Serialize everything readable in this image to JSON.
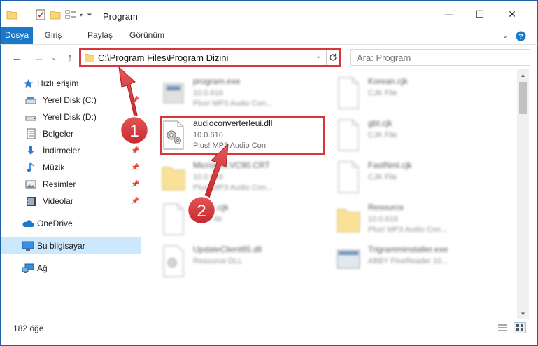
{
  "window": {
    "title": "Program",
    "controls": {
      "minimize": "—",
      "maximize": "☐",
      "close": "✕"
    }
  },
  "ribbon": {
    "tabs": [
      "Dosya",
      "Giriş",
      "Paylaş",
      "Görünüm"
    ]
  },
  "address": {
    "path": "C:\\Program Files\\Program Dizini",
    "search_placeholder": "Ara: Program"
  },
  "navpane": {
    "quick_access": "Hızlı erişim",
    "items": [
      {
        "label": "Yerel Disk (C:)",
        "icon": "drive-icon",
        "pinned": true
      },
      {
        "label": "Yerel Disk (D:)",
        "icon": "drive-icon",
        "pinned": false
      },
      {
        "label": "Belgeler",
        "icon": "documents-icon",
        "pinned": true
      },
      {
        "label": "İndirmeler",
        "icon": "downloads-icon",
        "pinned": true
      },
      {
        "label": "Müzik",
        "icon": "music-icon",
        "pinned": true
      },
      {
        "label": "Resimler",
        "icon": "pictures-icon",
        "pinned": true
      },
      {
        "label": "Videolar",
        "icon": "videos-icon",
        "pinned": true
      }
    ],
    "onedrive": "OneDrive",
    "this_pc": "Bu bilgisayar",
    "network": "Ağ"
  },
  "files": [
    {
      "name": "program.exe",
      "line2": "10.0.616",
      "line3": "Plus! MP3 Audio Con...",
      "icon": "exe-icon",
      "blurred": true
    },
    {
      "name": "Korean.cjk",
      "line2": "CJK File",
      "line3": "",
      "icon": "file-icon",
      "blurred": true
    },
    {
      "name": "audioconverterleui.dll",
      "line2": "10.0.616",
      "line3": "Plus! MP3 Audio Con...",
      "icon": "dll-icon",
      "blurred": false
    },
    {
      "name": "gbt.cjk",
      "line2": "CJK File",
      "line3": "",
      "icon": "file-icon",
      "blurred": true
    },
    {
      "name": "Microsoft.VC90.CRT",
      "line2": "10.0.616",
      "line3": "Plus! MP3 Audio Con...",
      "icon": "folder-icon",
      "blurred": true
    },
    {
      "name": "FastNml.cjk",
      "line2": "CJK File",
      "line3": "",
      "icon": "file-icon",
      "blurred": true
    },
    {
      "name": "Japan.cjk",
      "line2": "CJK File",
      "line3": "",
      "icon": "file-icon",
      "blurred": true
    },
    {
      "name": "Resource",
      "line2": "10.0.616",
      "line3": "Plus! MP3 Audio Con...",
      "icon": "folder-icon",
      "blurred": true
    },
    {
      "name": "UpdateClient65.dll",
      "line2": "Resource DLL",
      "line3": "",
      "icon": "dll-icon",
      "blurred": true
    },
    {
      "name": "Trigramminstaller.exe",
      "line2": "ABBY FineReader 10...",
      "line3": "",
      "icon": "installer-icon",
      "blurred": true
    }
  ],
  "status": {
    "item_count": "182 öğe"
  },
  "callouts": [
    "1",
    "2"
  ],
  "colors": {
    "accent": "#1979ca",
    "highlight": "#d9363c",
    "selected": "#cce8ff"
  }
}
